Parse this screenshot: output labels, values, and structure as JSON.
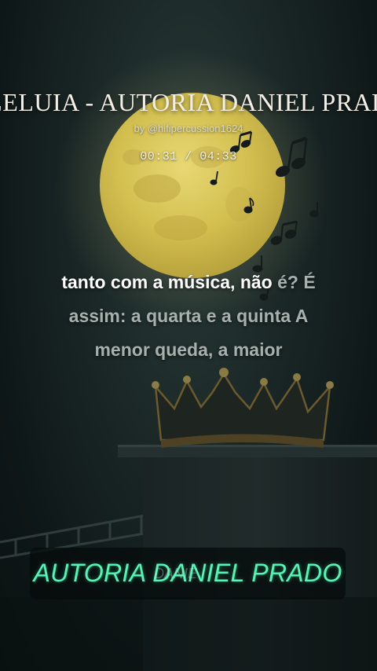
{
  "video": {
    "title": "ALELUIA - AUTORIA DANIEL PRADO",
    "byline": "by @hifipercussion1624",
    "time_current": "00:31",
    "time_sep": " / ",
    "time_total": "04:33"
  },
  "lyrics": {
    "line1_sung": "tanto com a música, não ",
    "line1_unsung": "é? É",
    "line2": "assim: a quarta e a quinta A",
    "line3": "menor queda, a maior"
  },
  "caption": {
    "text": "AUTORIA DANIEL PRADO",
    "ghost": "DANIE"
  },
  "colors": {
    "caption": "#55f5b6",
    "moon": "#d8c65a",
    "background": "#1a2726"
  },
  "icons": [
    "music-note-icon",
    "crown-icon",
    "moon-icon"
  ]
}
